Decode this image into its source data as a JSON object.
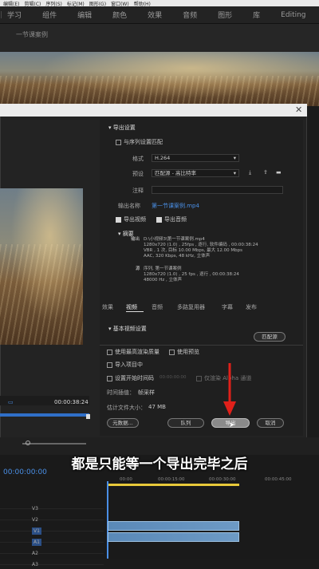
{
  "menubar": [
    "编辑(E)",
    "剪辑(C)",
    "序列(S)",
    "标记(M)",
    "图形(G)",
    "窗口(W)",
    "帮助(H)"
  ],
  "workspace_tabs": [
    "学习",
    "组件",
    "编辑",
    "颜色",
    "效果",
    "音频",
    "图形",
    "库",
    "Editing"
  ],
  "source_title": "一节课案例",
  "export_settings": {
    "header": "导出设置",
    "match_sequence": "与序列设置匹配",
    "format_label": "格式",
    "format_value": "H.264",
    "preset_label": "预设",
    "preset_value": "匹配源 - 高比特率",
    "comment_label": "注释",
    "output_name_label": "输出名称",
    "output_name_value": "第一节课案例.mp4",
    "export_video": "导出视频",
    "export_audio": "导出音频",
    "summary_header": "摘要",
    "output_label": "输出",
    "output_lines": [
      "D:\\小视频3\\第一节课案例.mp4",
      "1280x720 (1.0) , 25fps , 逐行, 软件编码 , 00:00:38:24",
      "VBR , 1 次, 目标 10.00 Mbps, 最大 12.00 Mbps",
      "AAC, 320 Kbps, 48 kHz, 立体声"
    ],
    "source_label": "源",
    "source_lines": [
      "序列, 第一节课案例",
      "1280x720 (1.0) , 25 fps , 逐行 , 00:00:38:24",
      "48000 Hz , 立体声"
    ]
  },
  "tabs": [
    "效果",
    "视频",
    "音频",
    "多路复用器",
    "字幕",
    "发布"
  ],
  "video_settings_header": "基本视频设置",
  "match_source_button": "匹配源",
  "options": {
    "max_render": "使用最高渲染质量",
    "use_preview": "使用预览",
    "import_project": "导入项目中",
    "set_start_timecode": "设置开始时间码",
    "start_timecode_value": "00:00:00:00",
    "render_alpha": "仅渲染 Alpha 通道",
    "time_interp_label": "时间插值：",
    "time_interp_value": "帧采样",
    "file_size_label": "估计文件大小：",
    "file_size_value": "47 MB"
  },
  "buttons": {
    "metadata": "元数据...",
    "queue": "队列",
    "export": "导出",
    "cancel": "取消"
  },
  "preview_timecode": "00:00:38:24",
  "timeline": {
    "timecode": "00:00:00:00",
    "ruler": [
      "00:00",
      "00:00:15:00",
      "00:00:30:00",
      "00:00:45:00"
    ],
    "tracks": [
      "V3",
      "V2",
      "V1",
      "A1",
      "A2",
      "A3"
    ]
  },
  "subtitle": "都是只能等一个导出完毕之后"
}
